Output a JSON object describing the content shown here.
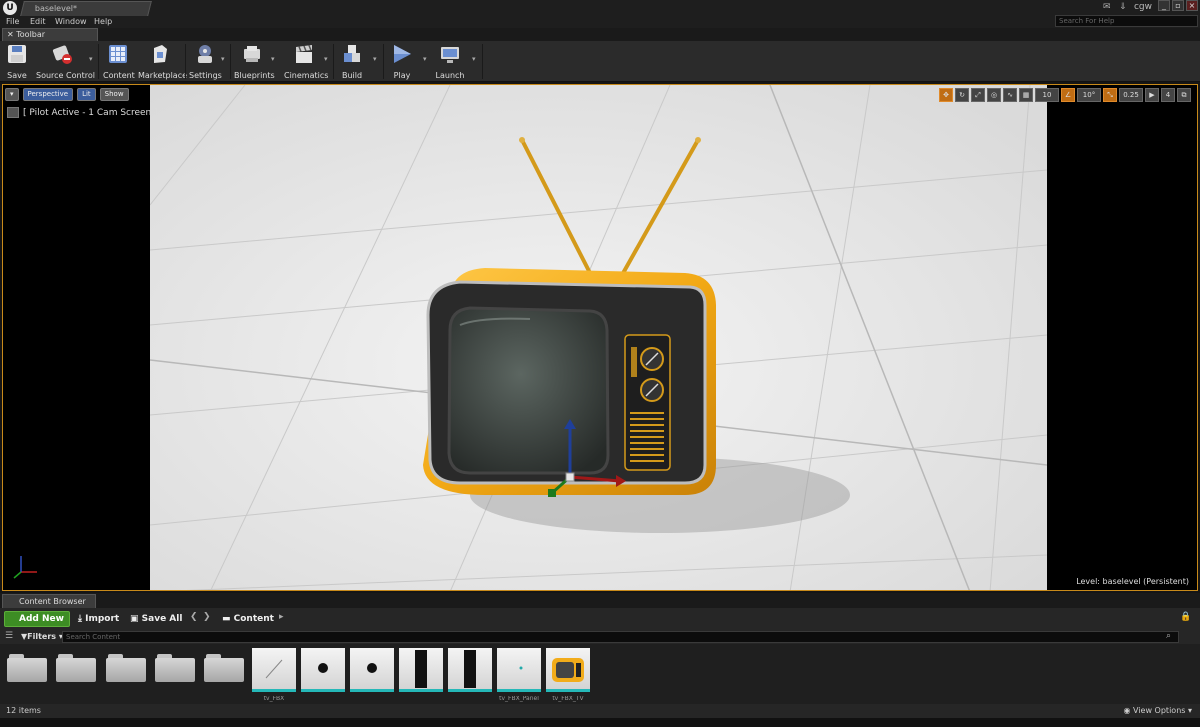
{
  "window": {
    "doc_tab": "baselevel*",
    "user_name": "cgw",
    "search_help_placeholder": "Search For Help",
    "minimize": "_",
    "restore": "▫",
    "close": "×"
  },
  "menu": [
    "File",
    "Edit",
    "Window",
    "Help"
  ],
  "toolbar": {
    "tab_label": "Toolbar",
    "tools": [
      {
        "label": "Save"
      },
      {
        "label": "Source Control"
      },
      {
        "label": "Content"
      },
      {
        "label": "Marketplace"
      },
      {
        "label": "Settings"
      },
      {
        "label": "Blueprints"
      },
      {
        "label": "Cinematics"
      },
      {
        "label": "Build"
      },
      {
        "label": "Play"
      },
      {
        "label": "Launch"
      }
    ]
  },
  "viewport": {
    "perspective": "Perspective",
    "lit": "Lit",
    "show": "Show",
    "pilot_label": "[ Pilot Active - 1 Cam Screen ]",
    "grid_snap": "10",
    "rotate_snap": "10°",
    "scale_snap": "0.25",
    "camera_speed": "4",
    "level_label": "Level:",
    "level_name": "baselevel (Persistent)"
  },
  "content_browser": {
    "tab_label": "Content Browser",
    "add_new": "Add New",
    "import": "Import",
    "save_all": "Save All",
    "path_root": "Content",
    "filters": "Filters",
    "search_placeholder": "Search Content",
    "items_count": "12 items",
    "view_options": "View Options",
    "asset_labels": [
      "tv_FBX",
      "",
      "",
      "",
      "",
      "tv_FBX_Panel",
      "tv_FBX_TV"
    ]
  },
  "colors": {
    "accent_orange": "#c88a1a",
    "add_new_green": "#3d8d24",
    "tv_yellow": "#f2ac1a",
    "asset_underline": "#25b8b8"
  }
}
